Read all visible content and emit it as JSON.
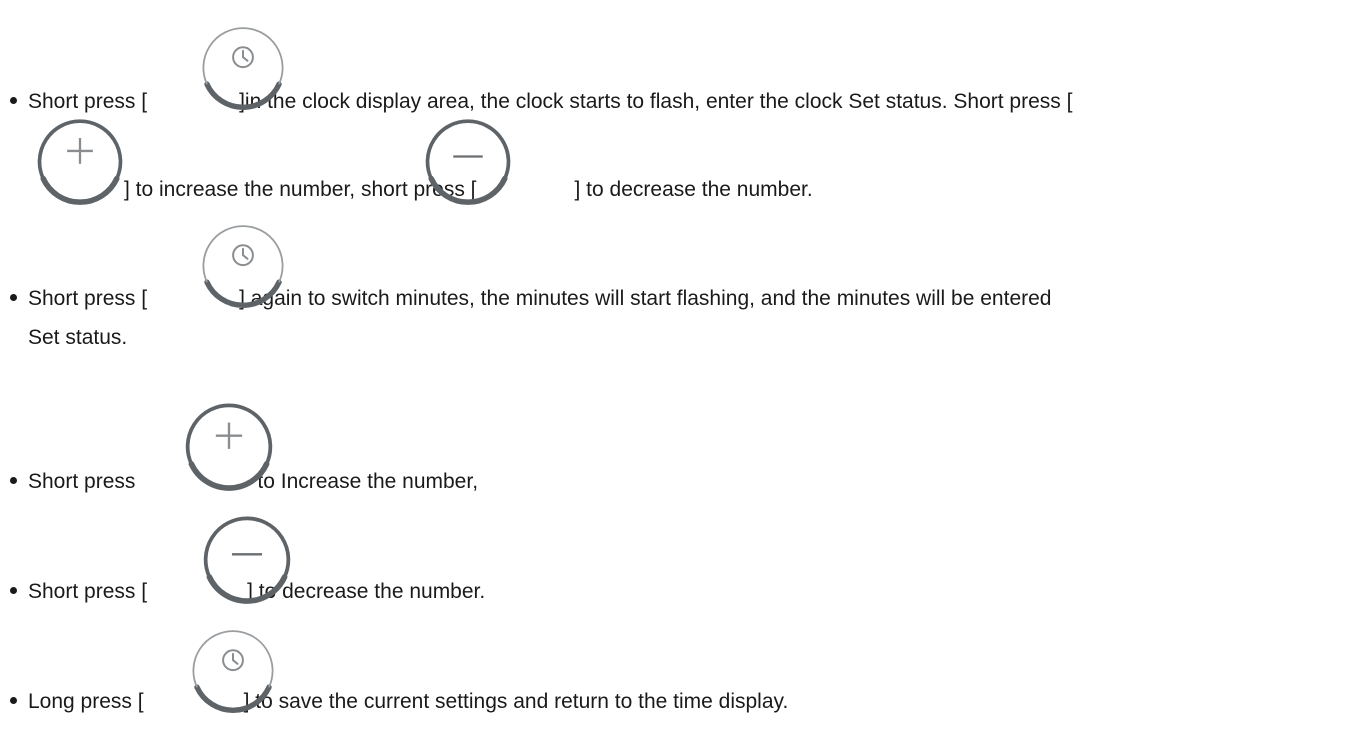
{
  "instructions": {
    "item1": {
      "part1": "Short press [",
      "part2": "]in the clock display area, the clock starts to flash, enter the clock Set status. Short press [",
      "part3": "] to increase the number, short press [",
      "part4": "] to decrease the number."
    },
    "item2": {
      "part1": "Short press [",
      "part2": "] again to switch minutes, the minutes will start flashing, and the minutes will be entered",
      "part3": "Set status."
    },
    "item3": {
      "part1": "Short press",
      "part2": "to Increase the number,"
    },
    "item4": {
      "part1": "Short press [",
      "part2": "] to decrease the number."
    },
    "item5": {
      "part1": "Long press [",
      "part2": "] to save the current settings and return to the time display."
    }
  },
  "icons": {
    "clock": "clock-icon",
    "plus": "plus-icon",
    "minus": "minus-icon"
  },
  "colors": {
    "text": "#1a1a1a",
    "icon_ring": "#5e6368",
    "icon_glyph": "#8a8d90"
  }
}
